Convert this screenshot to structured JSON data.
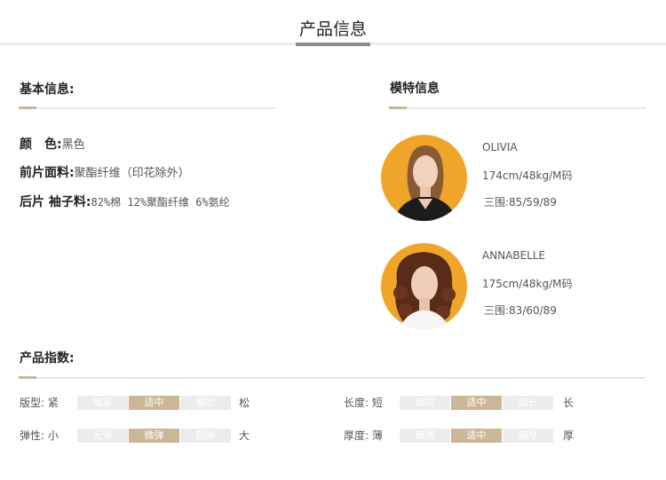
{
  "header": {
    "title": "产品信息"
  },
  "basic_info": {
    "title": "基本信息:",
    "rows": [
      {
        "label": "颜　色:",
        "value": "黑色"
      },
      {
        "label": "前片面料:",
        "value": "聚酯纤维（印花除外）"
      },
      {
        "label": "后片 袖子料:",
        "value": "82%棉 12%聚酯纤维 6%氨纶"
      }
    ]
  },
  "model_info": {
    "title": "模特信息",
    "models": [
      {
        "name": "OLIVIA",
        "size": "174cm/48kg/M码",
        "measurements": "三围:85/59/89"
      },
      {
        "name": "ANNABELLE",
        "size": "175cm/48kg/M码",
        "measurements": "三围:83/60/89"
      }
    ]
  },
  "product_index": {
    "title": "产品指数:",
    "rows": [
      {
        "label": "版型:",
        "low": "紧",
        "options": [
          "偏紧",
          "适中",
          "偏松"
        ],
        "selected": "适中",
        "high": "松"
      },
      {
        "label": "长度:",
        "low": "短",
        "options": [
          "偏短",
          "适中",
          "偏长"
        ],
        "selected": "适中",
        "high": "长"
      },
      {
        "label": "弹性:",
        "low": "小",
        "options": [
          "无弹",
          "微弹",
          "超弹"
        ],
        "selected": "微弹",
        "high": "大"
      },
      {
        "label": "厚度:",
        "low": "薄",
        "options": [
          "偏薄",
          "适中",
          "偏厚"
        ],
        "selected": "适中",
        "high": "厚"
      }
    ]
  },
  "colors": {
    "accent": "#c9b79a",
    "avatar_bg": "#f0a52a",
    "active_segment": "#cbb797",
    "inactive_segment": "#ececec"
  }
}
